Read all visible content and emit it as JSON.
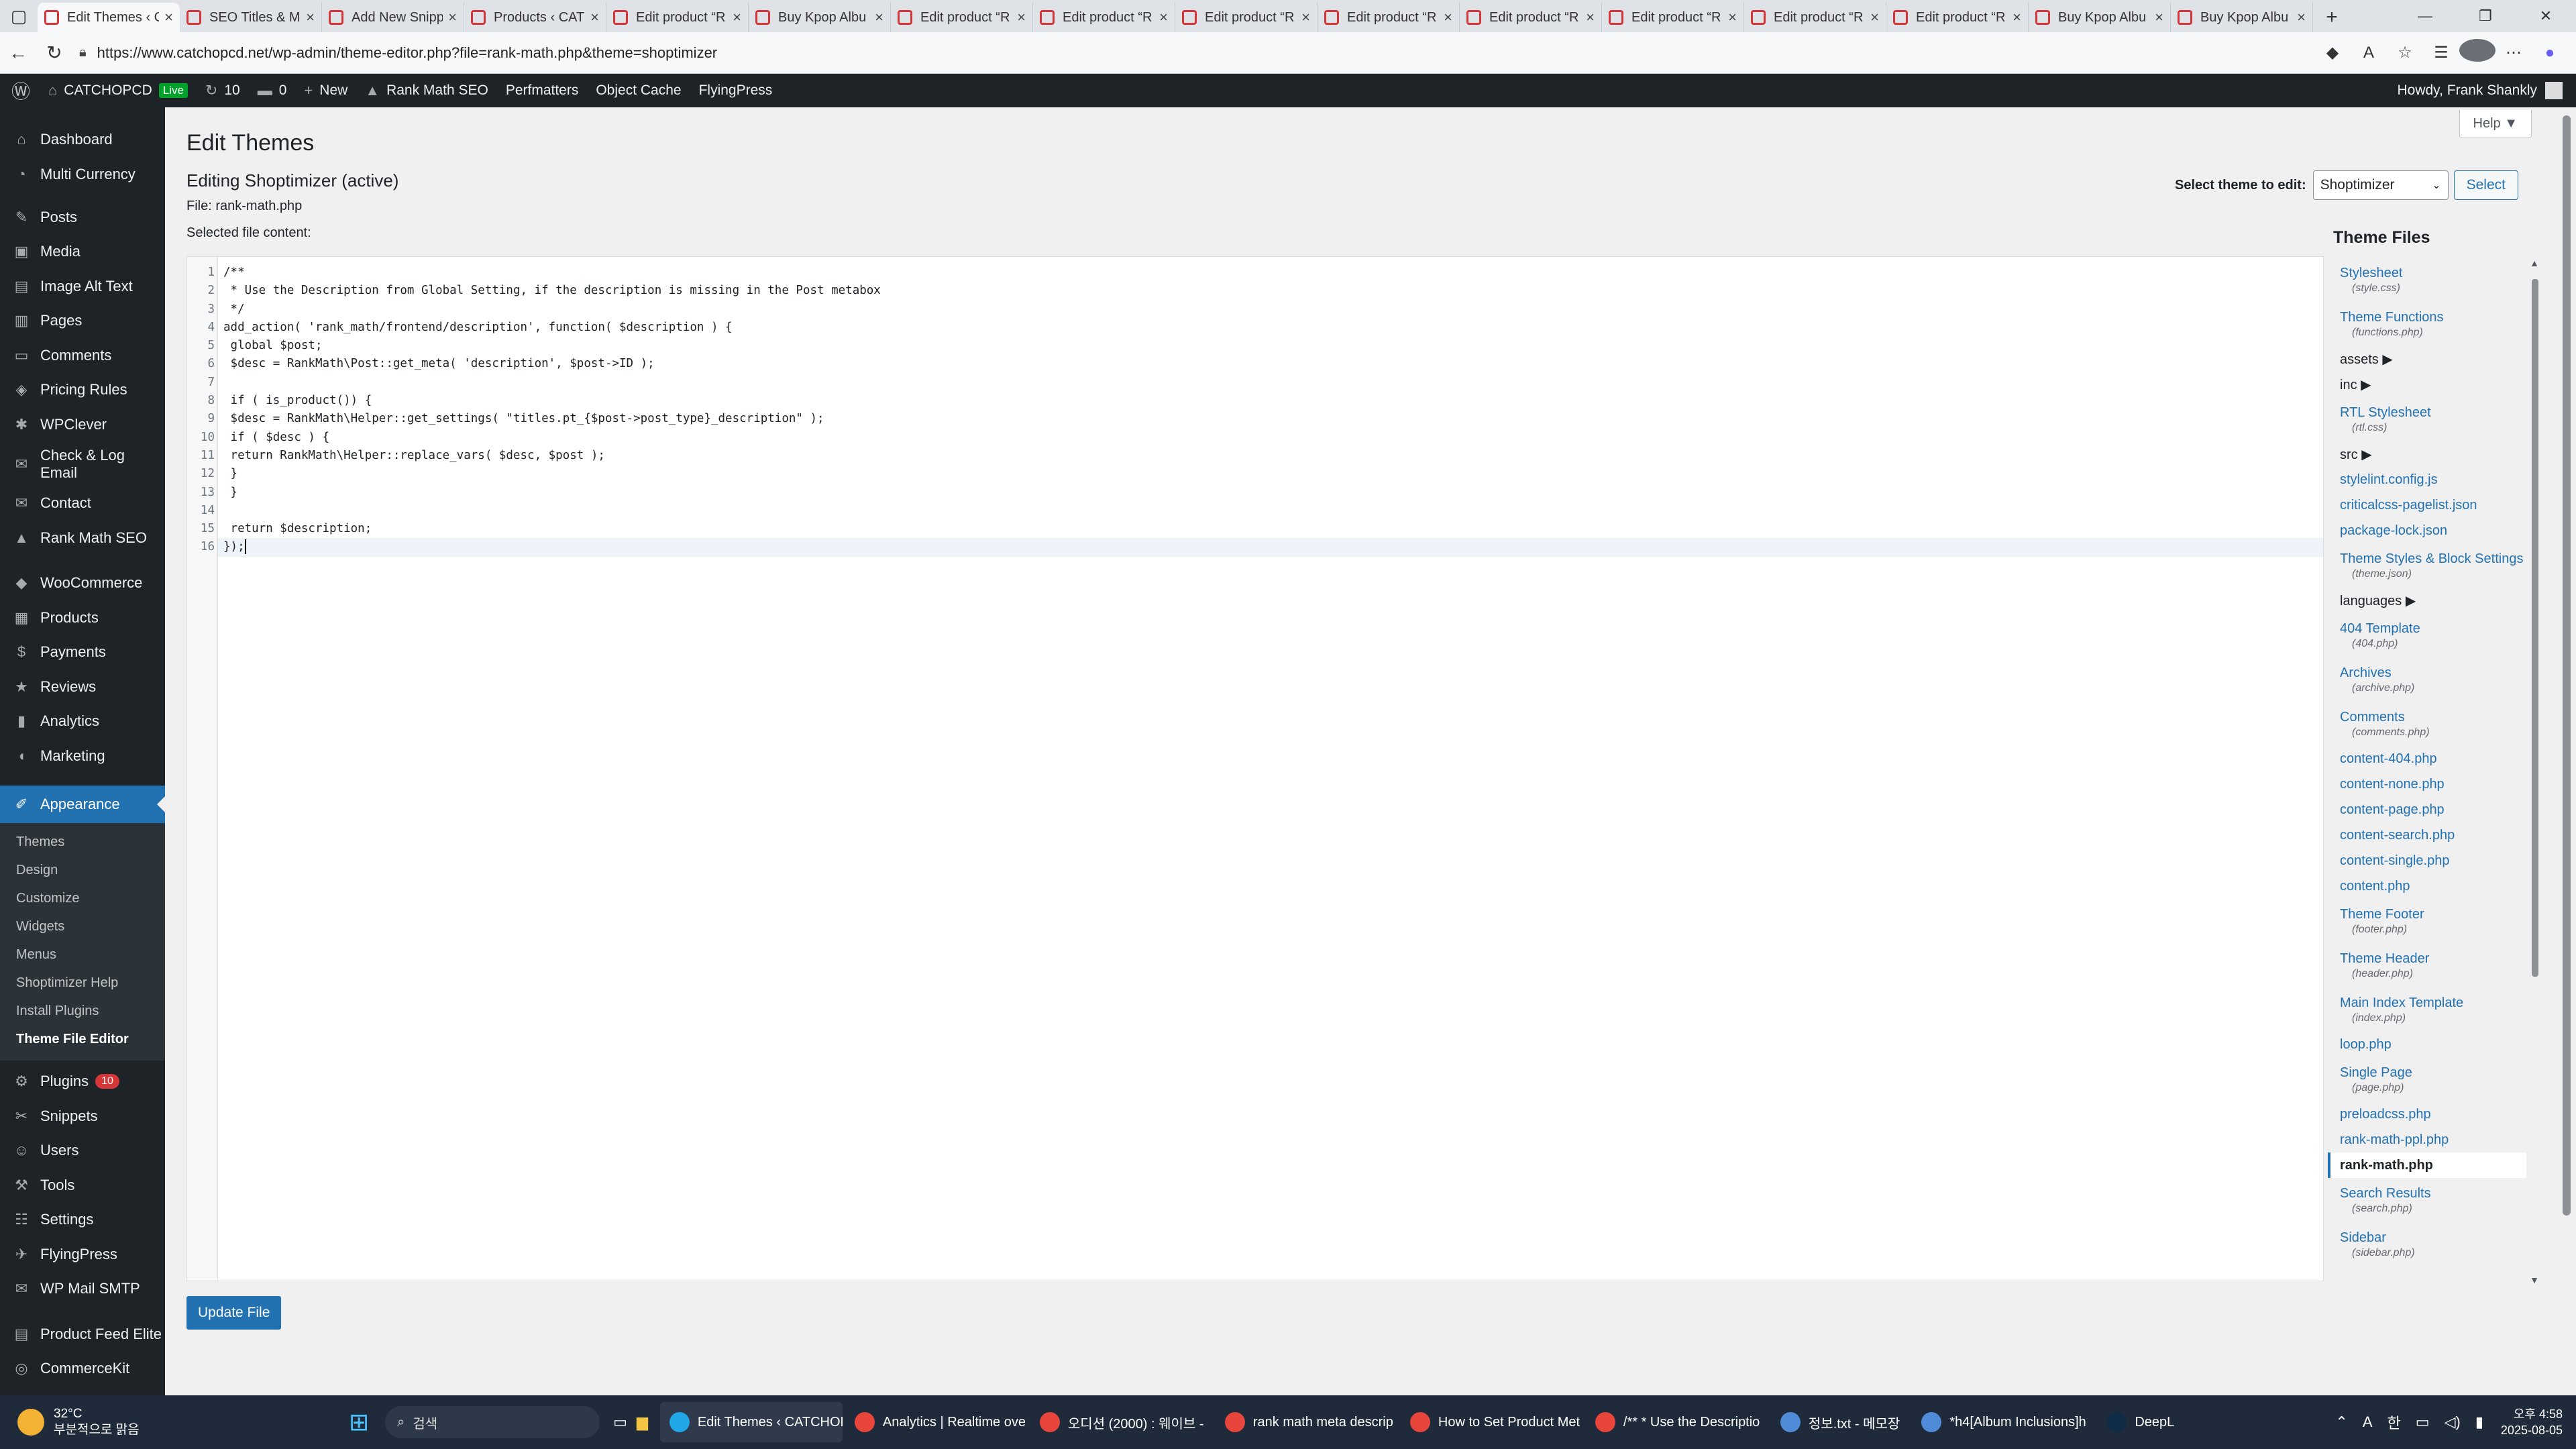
{
  "browser": {
    "tabs": [
      {
        "title": "Edit Themes ‹ C",
        "active": true
      },
      {
        "title": "SEO Titles & M"
      },
      {
        "title": "Add New Snipp"
      },
      {
        "title": "Products ‹ CAT"
      },
      {
        "title": "Edit product “R"
      },
      {
        "title": "Buy Kpop Albu"
      },
      {
        "title": "Edit product “R"
      },
      {
        "title": "Edit product “R"
      },
      {
        "title": "Edit product “R"
      },
      {
        "title": "Edit product “R"
      },
      {
        "title": "Edit product “R"
      },
      {
        "title": "Edit product “R"
      },
      {
        "title": "Edit product “R"
      },
      {
        "title": "Edit product “R"
      },
      {
        "title": "Buy Kpop Albu"
      },
      {
        "title": "Buy Kpop Albu"
      }
    ],
    "url": "https://www.catchopcd.net/wp-admin/theme-editor.php?file=rank-math.php&theme=shoptimizer"
  },
  "adminbar": {
    "site_name": "CATCHOPCD",
    "live_label": "Live",
    "updates_count": "10",
    "comments_count": "0",
    "new_label": "New",
    "items": [
      "Rank Math SEO",
      "Perfmatters",
      "Object Cache",
      "FlyingPress"
    ],
    "howdy": "Howdy, Frank Shankly"
  },
  "sidebar": {
    "top": [
      {
        "label": "Dashboard",
        "icon": "⌂"
      },
      {
        "label": "Multi Currency",
        "icon": "◔"
      }
    ],
    "group2": [
      {
        "label": "Posts",
        "icon": "✎"
      },
      {
        "label": "Media",
        "icon": "▣"
      },
      {
        "label": "Image Alt Text",
        "icon": "▤"
      },
      {
        "label": "Pages",
        "icon": "▥"
      },
      {
        "label": "Comments",
        "icon": "▭"
      },
      {
        "label": "Pricing Rules",
        "icon": "◈"
      },
      {
        "label": "WPClever",
        "icon": "✱"
      },
      {
        "label": "Check & Log",
        "label2": "Email",
        "icon": "✉"
      },
      {
        "label": "Contact",
        "icon": "✉"
      },
      {
        "label": "Rank Math SEO",
        "icon": "▲"
      }
    ],
    "group3": [
      {
        "label": "WooCommerce",
        "icon": "◆"
      },
      {
        "label": "Products",
        "icon": "▦"
      },
      {
        "label": "Payments",
        "icon": "$"
      },
      {
        "label": "Reviews",
        "icon": "★"
      },
      {
        "label": "Analytics",
        "icon": "▮"
      },
      {
        "label": "Marketing",
        "icon": "◖"
      }
    ],
    "appearance": {
      "label": "Appearance",
      "icon": "✐"
    },
    "submenu": [
      "Themes",
      "Design",
      "Customize",
      "Widgets",
      "Menus",
      "Shoptimizer Help",
      "Install Plugins",
      "Theme File Editor"
    ],
    "bottom": [
      {
        "label": "Plugins",
        "icon": "⚙",
        "badge": "10"
      },
      {
        "label": "Snippets",
        "icon": "✂"
      },
      {
        "label": "Users",
        "icon": "☺"
      },
      {
        "label": "Tools",
        "icon": "⚒"
      },
      {
        "label": "Settings",
        "icon": "☷"
      },
      {
        "label": "FlyingPress",
        "icon": "✈"
      },
      {
        "label": "WP Mail SMTP",
        "icon": "✉"
      }
    ],
    "bottom2": [
      {
        "label": "Product Feed Elite",
        "icon": "▤"
      },
      {
        "label": "CommerceKit",
        "icon": "◎"
      }
    ]
  },
  "main": {
    "help_label": "Help ▼",
    "title": "Edit Themes",
    "editing_heading": "Editing Shoptimizer (active)",
    "file_line": "File: rank-math.php",
    "selected_label": "Selected file content:",
    "select_theme_label": "Select theme to edit:",
    "selected_theme": "Shoptimizer",
    "select_button": "Select",
    "update_button": "Update File",
    "code_lines": [
      "/**",
      " * Use the Description from Global Setting, if the description is missing in the Post metabox",
      " */",
      "add_action( 'rank_math/frontend/description', function( $description ) {",
      " global $post;",
      " $desc = RankMath\\Post::get_meta( 'description', $post->ID );",
      "",
      " if ( is_product()) {",
      " $desc = RankMath\\Helper::get_settings( \"titles.pt_{$post->post_type}_description\" );",
      " if ( $desc ) {",
      " return RankMath\\Helper::replace_vars( $desc, $post );",
      " }",
      " }",
      "",
      " return $description;",
      "});"
    ],
    "line_numbers": [
      "1",
      "2",
      "3",
      "4",
      "5",
      "6",
      "7",
      "8",
      "9",
      "10",
      "11",
      "12",
      "13",
      "14",
      "15",
      "16"
    ]
  },
  "theme_files": {
    "title": "Theme Files",
    "entries": [
      {
        "name": "Stylesheet",
        "sub": "(style.css)"
      },
      {
        "name": "Theme Functions",
        "sub": "(functions.php)"
      },
      {
        "folder": "assets ▶"
      },
      {
        "folder": "inc ▶"
      },
      {
        "name": "RTL Stylesheet",
        "sub": "(rtl.css)"
      },
      {
        "folder": "src ▶"
      },
      {
        "name": "stylelint.config.js"
      },
      {
        "name": "criticalcss-pagelist.json"
      },
      {
        "name": "package-lock.json"
      },
      {
        "name": "Theme Styles & Block Settings",
        "sub": "(theme.json)"
      },
      {
        "folder": "languages ▶"
      },
      {
        "name": "404 Template",
        "sub": "(404.php)"
      },
      {
        "name": "Archives",
        "sub": "(archive.php)"
      },
      {
        "name": "Comments",
        "sub": "(comments.php)"
      },
      {
        "name": "content-404.php"
      },
      {
        "name": "content-none.php"
      },
      {
        "name": "content-page.php"
      },
      {
        "name": "content-search.php"
      },
      {
        "name": "content-single.php"
      },
      {
        "name": "content.php"
      },
      {
        "name": "Theme Footer",
        "sub": "(footer.php)"
      },
      {
        "name": "Theme Header",
        "sub": "(header.php)"
      },
      {
        "name": "Main Index Template",
        "sub": "(index.php)"
      },
      {
        "name": "loop.php"
      },
      {
        "name": "Single Page",
        "sub": "(page.php)"
      },
      {
        "name": "preloadcss.php"
      },
      {
        "name": "rank-math-ppl.php"
      },
      {
        "name": "rank-math.php",
        "current": true
      },
      {
        "name": "Search Results",
        "sub": "(search.php)"
      },
      {
        "name": "Sidebar",
        "sub": "(sidebar.php)"
      }
    ]
  },
  "taskbar": {
    "weather_temp": "32°C",
    "weather_desc": "부분적으로 맑음",
    "search_placeholder": "검색",
    "apps": [
      {
        "label": "Edit Themes ‹ CATCHOP",
        "color": "#1fa7e8",
        "active": true
      },
      {
        "label": "Analytics | Realtime ove",
        "color": "#e8453c"
      },
      {
        "label": "오디션 (2000) : 웨이브 -",
        "color": "#e8453c"
      },
      {
        "label": "rank math meta descrip",
        "color": "#e8453c"
      },
      {
        "label": "How to Set Product Met",
        "color": "#e8453c"
      },
      {
        "label": "/** * Use the Descriptio",
        "color": "#e8453c"
      },
      {
        "label": "정보.txt - 메모장",
        "color": "#4f8bd6"
      },
      {
        "label": "*h4[Album Inclusions]h",
        "color": "#4f8bd6"
      },
      {
        "label": "DeepL",
        "color": "#0f2b46"
      }
    ],
    "time": "오후 4:58",
    "date": "2025-08-05"
  }
}
